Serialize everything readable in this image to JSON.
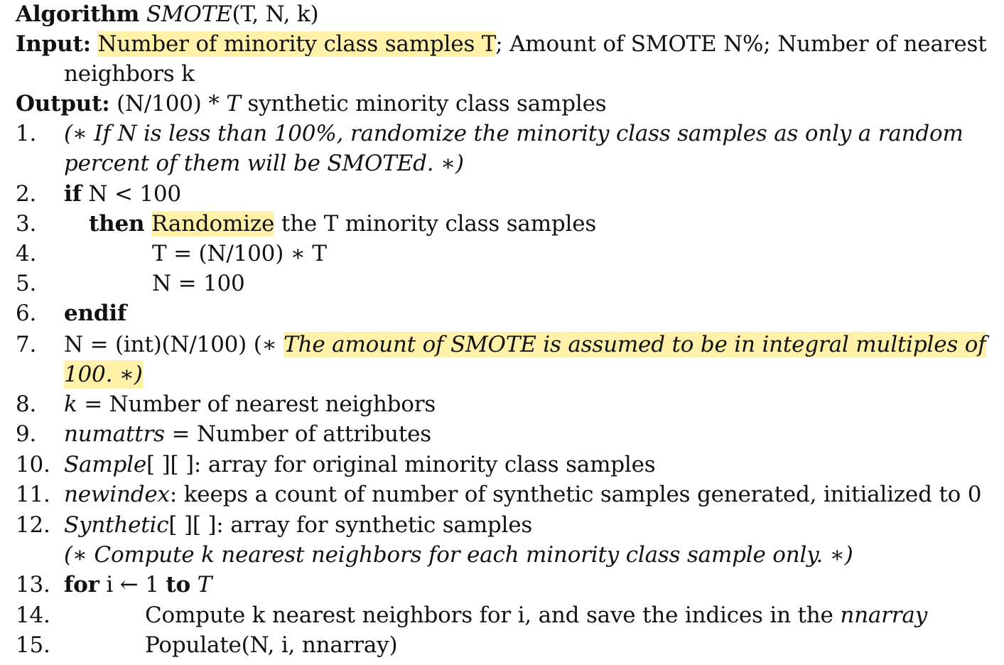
{
  "title": {
    "keyword": "Algorithm",
    "name": "SMOTE",
    "args": "(T,  N,  k)"
  },
  "input": {
    "label": "Input:",
    "highlighted": "Number of minority class samples T",
    "rest_line1": "; Amount of SMOTE N%; Number of nearest",
    "rest_line2": "neighbors k"
  },
  "output": {
    "label": "Output:",
    "text_prefix": "(N/100) * ",
    "text_var": "T",
    "text_suffix": " synthetic minority class samples"
  },
  "lines": [
    {
      "num": "1.",
      "line1": "(∗ If N is less than 100%, randomize the minority class samples as only a random",
      "line2": "percent of them will be SMOTEd. ∗)"
    },
    {
      "num": "2.",
      "kw": "if",
      "text": " N < 100"
    },
    {
      "num": "3.",
      "kw": "then",
      "highlighted": "Randomize",
      "text": " the T minority class samples"
    },
    {
      "num": "4.",
      "text": "T = (N/100) ∗ T"
    },
    {
      "num": "5.",
      "text": "N = 100"
    },
    {
      "num": "6.",
      "kw": "endif"
    },
    {
      "num": "7.",
      "text": "N = (int)(N/100) (∗ ",
      "highlighted": "The amount of SMOTE is assumed to be in integral multiples of",
      "highlighted2": "100. ∗)"
    },
    {
      "num": "8.",
      "var": "k",
      "text": " = Number of nearest neighbors"
    },
    {
      "num": "9.",
      "var": "numattrs",
      "text": " = Number of attributes"
    },
    {
      "num": "10.",
      "var": "Sample",
      "text": "[ ][ ]: array for original minority class samples"
    },
    {
      "num": "11.",
      "var": "newindex",
      "text": ": keeps a count of number of synthetic samples generated, initialized to 0"
    },
    {
      "num": "12.",
      "var": "Synthetic",
      "text": "[ ][ ]: array for synthetic samples"
    },
    {
      "num": "",
      "comment": "(∗ Compute k nearest neighbors for each minority class sample only. ∗)"
    },
    {
      "num": "13.",
      "kw": "for",
      "text": " i ← 1 ",
      "kw2": "to",
      "text2": " T"
    },
    {
      "num": "14.",
      "text": "Compute k nearest neighbors for i, and save the indices in the ",
      "var": "nnarray"
    },
    {
      "num": "15.",
      "text": "Populate(N, i, nnarray)"
    }
  ]
}
